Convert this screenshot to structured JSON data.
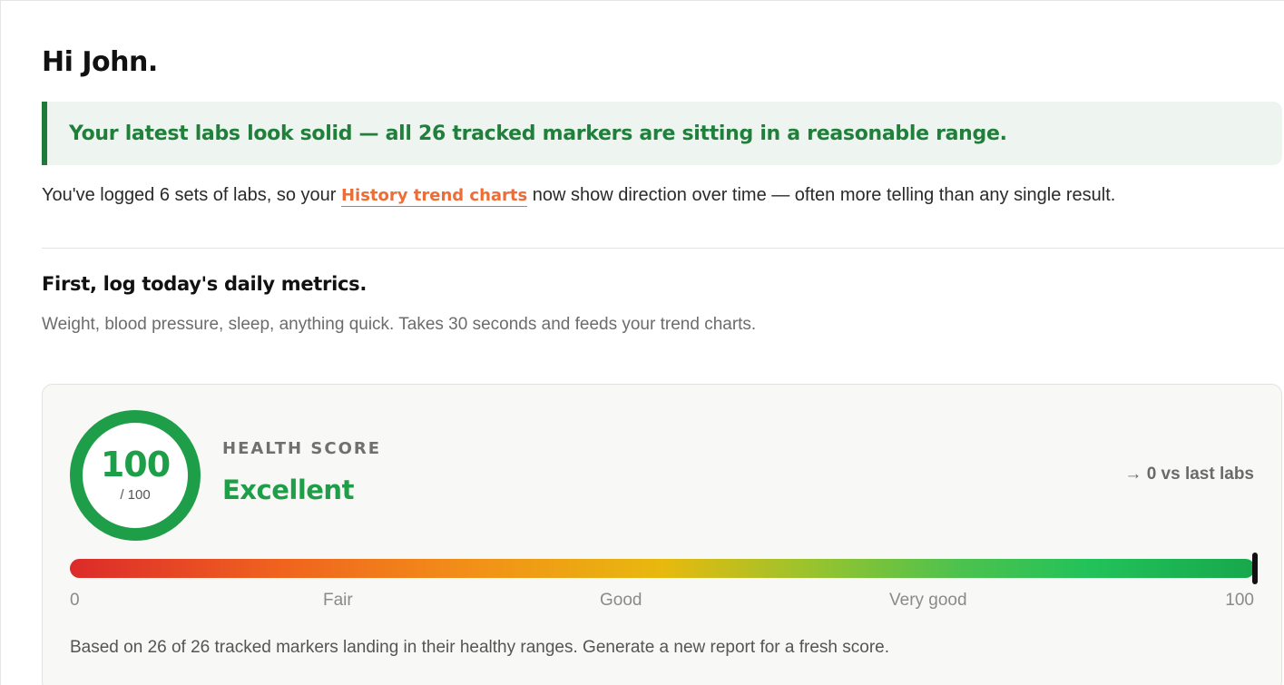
{
  "greeting": "Hi John.",
  "banner": {
    "text": "Your latest labs look solid — all 26 tracked markers are sitting in a reasonable range.",
    "accent_color": "#1f7a3a"
  },
  "history_note": {
    "prefix": "You've logged 6 sets of labs, so your ",
    "link_text": "History trend charts",
    "suffix": " now show direction over time — often more telling than any single result.",
    "link_color": "#ee6c36"
  },
  "daily_metrics": {
    "title": "First, log today's daily metrics.",
    "description": "Weight, blood pressure, sleep, anything quick. Takes 30 seconds and feeds your trend charts."
  },
  "health_score": {
    "value": "100",
    "out_of": "/ 100",
    "label": "HEALTH SCORE",
    "rating": "Excellent",
    "delta": "→ 0 vs last labs",
    "score_fraction": 1.0,
    "ring_color": "#1e9e48",
    "scale_labels": {
      "min": "0",
      "fair": "Fair",
      "good": "Good",
      "very_good": "Very good",
      "max": "100"
    },
    "note": "Based on 26 of 26 tracked markers landing in their healthy ranges. Generate a new report for a fresh score."
  }
}
